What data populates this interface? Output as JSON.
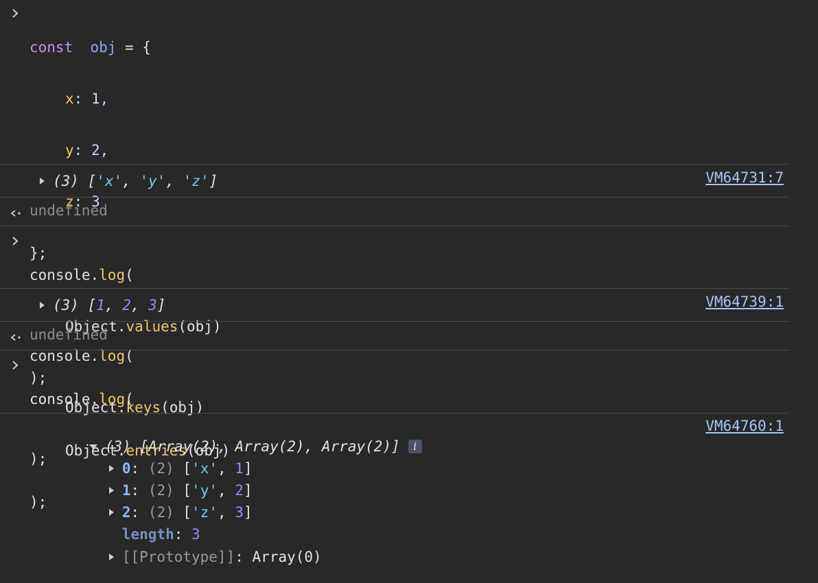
{
  "input1": {
    "lines": [
      [
        "const ",
        " obj",
        " = {"
      ],
      [
        "x",
        ": 1,"
      ],
      [
        "y",
        ": 2,"
      ],
      [
        "z",
        ": 3"
      ],
      [
        "};"
      ]
    ],
    "line6_a": "console.",
    "line6_b": "log",
    "line6_c": "(",
    "line7_a": "Object.",
    "line7_b": "keys",
    "line7_c": "(obj)",
    "line8": ");"
  },
  "output1": {
    "count": "(3)",
    "open": " [",
    "v1": "'x'",
    "c1": ", ",
    "v2": "'y'",
    "c2": ", ",
    "v3": "'z'",
    "close": "]",
    "source": "VM64731:7"
  },
  "result1": "undefined",
  "input2": {
    "l1a": "console.",
    "l1b": "log",
    "l1c": "(",
    "l2a": "Object.",
    "l2b": "values",
    "l2c": "(obj)",
    "l3": ");"
  },
  "output2": {
    "count": "(3)",
    "open": " [",
    "v1": "1",
    "c1": ", ",
    "v2": "2",
    "c2": ", ",
    "v3": "3",
    "close": "]",
    "source": "VM64739:1"
  },
  "result2": "undefined",
  "input3": {
    "l1a": "console.",
    "l1b": "log",
    "l1c": "(",
    "l2a": "Object.",
    "l2b": "entries",
    "l2c": "(obj)",
    "l3": ");"
  },
  "output3": {
    "summary": "(3) [Array(2), Array(2), Array(2)]",
    "info": "i",
    "source": "VM64760:1",
    "items": [
      {
        "key": "0",
        "count": "(2)",
        "open": " [",
        "s": "'x'",
        "sep": ", ",
        "n": "1",
        "close": "]"
      },
      {
        "key": "1",
        "count": "(2)",
        "open": " [",
        "s": "'y'",
        "sep": ", ",
        "n": "2",
        "close": "]"
      },
      {
        "key": "2",
        "count": "(2)",
        "open": " [",
        "s": "'z'",
        "sep": ", ",
        "n": "3",
        "close": "]"
      }
    ],
    "length_key": "length",
    "length_val": "3",
    "proto_key": "[[Prototype]]",
    "proto_val": "Array(0)"
  },
  "colors": {
    "background": "#282828",
    "keyword": "#c792ea",
    "property": "#f3c86a",
    "string": "#7cc9ef",
    "number": "#9b8cf5",
    "link": "#a9c5f5"
  }
}
